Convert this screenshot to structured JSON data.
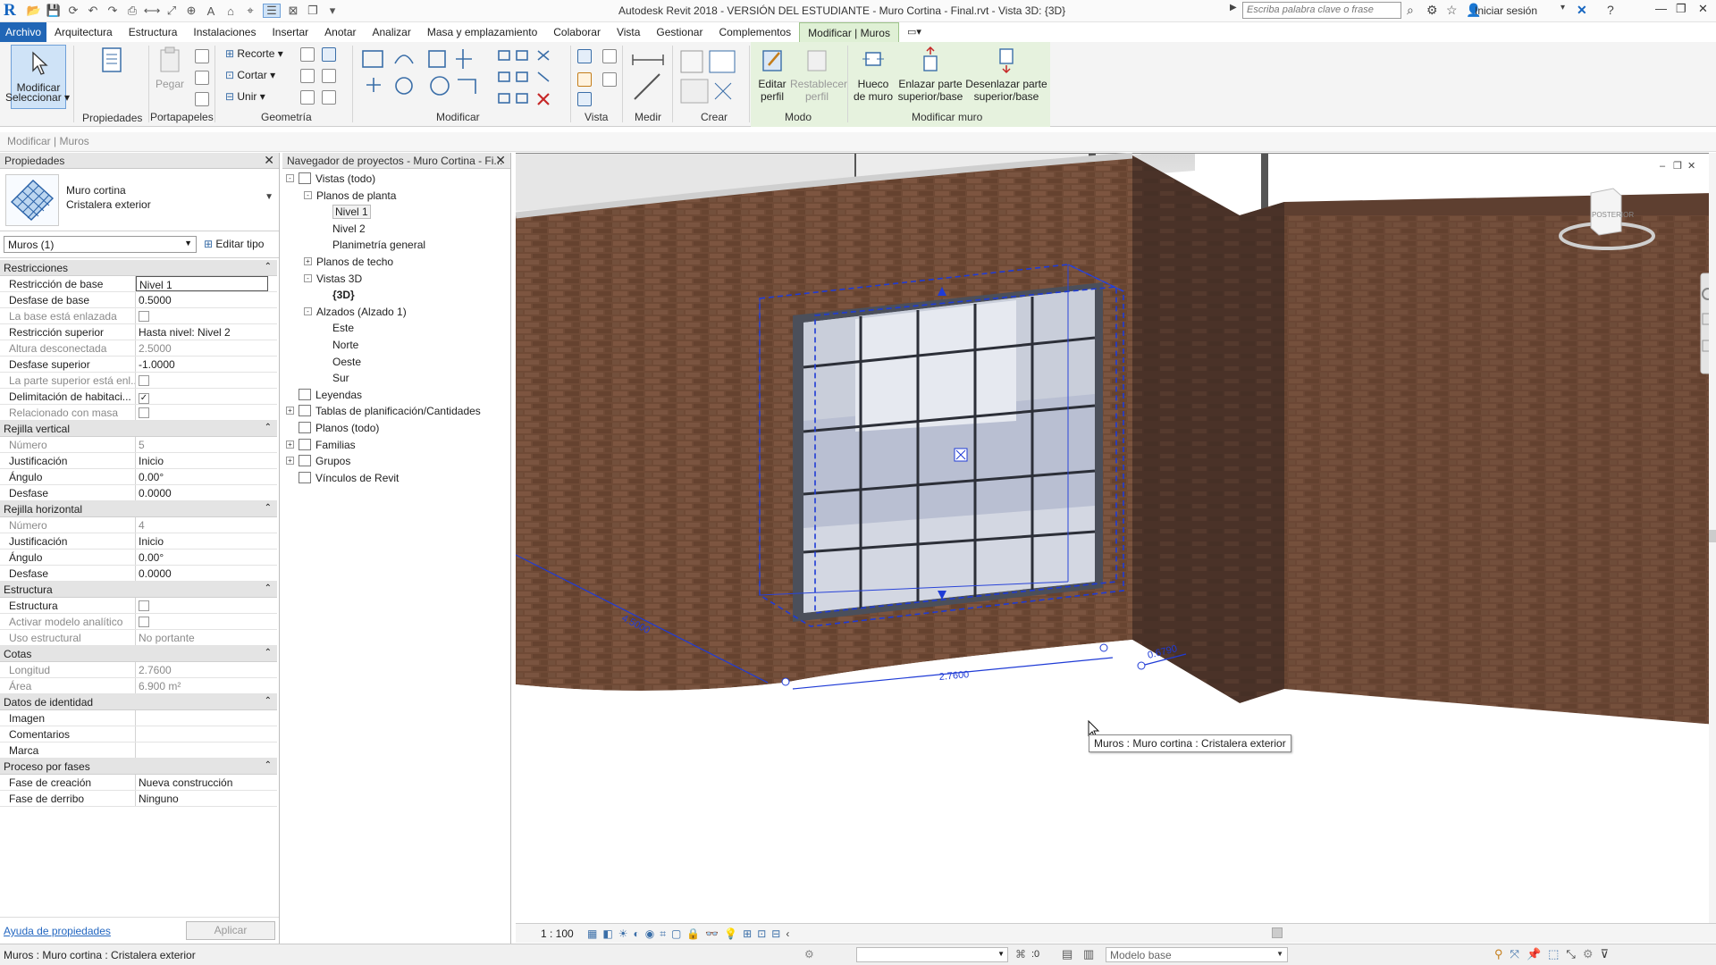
{
  "titlebar": {
    "title": "Autodesk Revit 2018 - VERSIÓN DEL ESTUDIANTE -     Muro Cortina - Final.rvt - Vista 3D: {3D}",
    "search_placeholder": "Escriba palabra clave o frase",
    "signin": "Iniciar sesión"
  },
  "tabs": [
    "Archivo",
    "Arquitectura",
    "Estructura",
    "Instalaciones",
    "Insertar",
    "Anotar",
    "Analizar",
    "Masa y emplazamiento",
    "Colaborar",
    "Vista",
    "Gestionar",
    "Complementos",
    "Modificar | Muros"
  ],
  "ribbon": {
    "modify": "Modificar",
    "select": "Seleccionar",
    "properties": "Propiedades",
    "paste": "Pegar",
    "clipboard": "Portapapeles",
    "cope": "Recorte",
    "cut": "Cortar",
    "join": "Unir",
    "geometry": "Geometría",
    "modify_panel": "Modificar",
    "view": "Vista",
    "measure": "Medir",
    "create": "Crear",
    "edit_profile": "Editar perfil",
    "reset_profile": "Restablecer perfil",
    "mode": "Modo",
    "wall_opening": "Hueco de muro",
    "attach": "Enlazar parte superior/base",
    "detach": "Desenlazar parte superior/base",
    "modify_wall": "Modificar muro"
  },
  "context_label": "Modificar | Muros",
  "properties": {
    "title": "Propiedades",
    "type_family": "Muro cortina",
    "type_name": "Cristalera exterior",
    "instance": "Muros (1)",
    "edit_type": "Editar tipo",
    "categories": [
      {
        "name": "Restricciones",
        "rows": [
          {
            "k": "Restricción de base",
            "v": "Nivel 1",
            "ro": false,
            "edit": true
          },
          {
            "k": "Desfase de base",
            "v": "0.5000",
            "ro": false
          },
          {
            "k": "La base está enlazada",
            "v": "",
            "cb": "off",
            "ro": true
          },
          {
            "k": "Restricción superior",
            "v": "Hasta nivel: Nivel 2",
            "ro": false
          },
          {
            "k": "Altura desconectada",
            "v": "2.5000",
            "ro": true
          },
          {
            "k": "Desfase superior",
            "v": "-1.0000",
            "ro": false
          },
          {
            "k": "La parte superior está enl...",
            "v": "",
            "cb": "off",
            "ro": true
          },
          {
            "k": "Delimitación de habitaci...",
            "v": "",
            "cb": "on",
            "ro": false
          },
          {
            "k": "Relacionado con masa",
            "v": "",
            "cb": "off",
            "ro": true
          }
        ]
      },
      {
        "name": "Rejilla vertical",
        "rows": [
          {
            "k": "Número",
            "v": "5",
            "ro": true
          },
          {
            "k": "Justificación",
            "v": "Inicio",
            "ro": false
          },
          {
            "k": "Ángulo",
            "v": "0.00°",
            "ro": false
          },
          {
            "k": "Desfase",
            "v": "0.0000",
            "ro": false
          }
        ]
      },
      {
        "name": "Rejilla horizontal",
        "rows": [
          {
            "k": "Número",
            "v": "4",
            "ro": true
          },
          {
            "k": "Justificación",
            "v": "Inicio",
            "ro": false
          },
          {
            "k": "Ángulo",
            "v": "0.00°",
            "ro": false
          },
          {
            "k": "Desfase",
            "v": "0.0000",
            "ro": false
          }
        ]
      },
      {
        "name": "Estructura",
        "rows": [
          {
            "k": "Estructura",
            "v": "",
            "cb": "off",
            "ro": false
          },
          {
            "k": "Activar modelo analítico",
            "v": "",
            "cb": "off",
            "ro": true
          },
          {
            "k": "Uso estructural",
            "v": "No portante",
            "ro": true
          }
        ]
      },
      {
        "name": "Cotas",
        "rows": [
          {
            "k": "Longitud",
            "v": "2.7600",
            "ro": true
          },
          {
            "k": "Área",
            "v": "6.900 m²",
            "ro": true
          }
        ]
      },
      {
        "name": "Datos de identidad",
        "rows": [
          {
            "k": "Imagen",
            "v": "",
            "ro": false
          },
          {
            "k": "Comentarios",
            "v": "",
            "ro": false
          },
          {
            "k": "Marca",
            "v": "",
            "ro": false
          }
        ]
      },
      {
        "name": "Proceso por fases",
        "rows": [
          {
            "k": "Fase de creación",
            "v": "Nueva construcción",
            "ro": false
          },
          {
            "k": "Fase de derribo",
            "v": "Ninguno",
            "ro": false
          }
        ]
      }
    ],
    "help": "Ayuda de propiedades",
    "apply": "Aplicar"
  },
  "navigator": {
    "title": "Navegador de proyectos - Muro Cortina - Fi...",
    "items": [
      {
        "label": "Vistas (todo)",
        "level": 0,
        "toggle": "-",
        "icon": true
      },
      {
        "label": "Planos de planta",
        "level": 1,
        "toggle": "-"
      },
      {
        "label": "Nivel 1",
        "level": 2,
        "selected": true
      },
      {
        "label": "Nivel 2",
        "level": 2
      },
      {
        "label": "Planimetría general",
        "level": 2
      },
      {
        "label": "Planos de techo",
        "level": 1,
        "toggle": "+"
      },
      {
        "label": "Vistas 3D",
        "level": 1,
        "toggle": "-"
      },
      {
        "label": "{3D}",
        "level": 2,
        "bold": true
      },
      {
        "label": "Alzados (Alzado 1)",
        "level": 1,
        "toggle": "-"
      },
      {
        "label": "Este",
        "level": 2
      },
      {
        "label": "Norte",
        "level": 2
      },
      {
        "label": "Oeste",
        "level": 2
      },
      {
        "label": "Sur",
        "level": 2
      },
      {
        "label": "Leyendas",
        "level": 0,
        "icon": true
      },
      {
        "label": "Tablas de planificación/Cantidades",
        "level": 0,
        "toggle": "+",
        "icon": true
      },
      {
        "label": "Planos (todo)",
        "level": 0,
        "icon": true
      },
      {
        "label": "Familias",
        "level": 0,
        "toggle": "+",
        "icon": true
      },
      {
        "label": "Grupos",
        "level": 0,
        "toggle": "+",
        "icon": true
      },
      {
        "label": "Vínculos de Revit",
        "level": 0,
        "icon": true
      }
    ]
  },
  "viewport": {
    "viewcube_label": "POSTERIOR",
    "dim_width": "2.7600",
    "dim_left": "4.5000",
    "dim_right": "0.6790",
    "tooltip": "Muros : Muro cortina : Cristalera exterior",
    "scale": "1 : 100"
  },
  "status": {
    "text": "Muros : Muro cortina : Cristalera exterior",
    "zero": ":0",
    "model": "Modelo base"
  },
  "colors": {
    "brick": "#6e4a36",
    "glass": "#b9bfd2",
    "selection": "#1f3bd6",
    "file_tab": "#2166b6",
    "context_tab": "#dff0d5"
  }
}
